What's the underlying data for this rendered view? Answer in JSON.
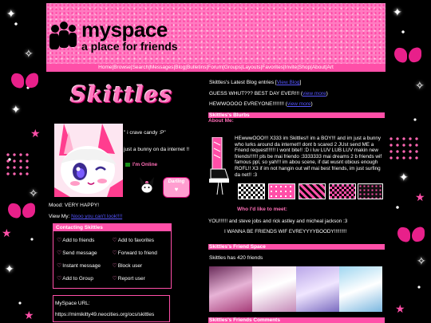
{
  "header": {
    "brand": "myspace",
    "tagline": "a place for friends"
  },
  "nav": {
    "items": [
      "Home",
      "Browse",
      "Search",
      "Messages",
      "Blog",
      "Bulletins",
      "Forum",
      "Groups",
      "Layouts",
      "Favorites",
      "Invite",
      "Shop",
      "About",
      "Art"
    ],
    "separator": "|"
  },
  "profile": {
    "display_name": "Skittles",
    "quotes": [
      "\" i crave candy :P\"",
      "just a bunny on da internet !!"
    ],
    "online_status": "I'm Online",
    "sticker_text": "Darling",
    "mood_label": "Mood:",
    "mood_value": "VERY HAPPY!",
    "view_my_label": "View My:",
    "view_my_link": "Nooo you can't look!!!!"
  },
  "contact": {
    "title": "Contacting Skittles",
    "items": [
      "Add to friends",
      "Add to favorites",
      "Send message",
      "Forward to friend",
      "Instant message",
      "Block user",
      "Add to Group",
      "Report user"
    ]
  },
  "url_box": {
    "label": "MySpace URL:",
    "url": "https://mimikitty49.neocities.org/ocs/skittles"
  },
  "blog": {
    "heading": "Skittles's Latest Blog entries",
    "heading_link": "View Blog",
    "entries": [
      {
        "text": "GUESS WHUT??? BEST DAY EVER!!!",
        "link": "view more"
      },
      {
        "text": "HEWWOOOO EVREYONE!!!!!!!!",
        "link": "view more"
      }
    ]
  },
  "blurbs": {
    "title": "Skittles's Blurbs",
    "about_label": "About Me:",
    "about_text": "HEwwwOOO!!! X333 im Skittles!! im a BOY!!! and im just a bunny who lurks around da internet!! dont b scared 2 JUst send ME a Friend request!!!!!! I wont bite!! :D i luv LUV LUB LUV makin new friends!!!!!! pls be mai friendo :3333333 mai dreams 2 b friends wif famous ppl, so yah!!! im abou scene, if dat wusnt obious enough ROFL!! X3 if im not hangin out wif mai best friends, im just surfing da net!! :3",
    "meet_label": "Who I'd like to meet:",
    "meet_text": "YOU!!!!!! and steve jobs and rick astley and micheal jackson :3",
    "wanna_text": "I WANNA BE FRIENDS WIF EVREYYYYBOODY!!!!!!!!!"
  },
  "friends": {
    "title": "Skittles's Friend Space",
    "count_text": "Skittles has 420 friends"
  },
  "comments": {
    "title": "Skittles's Friends Comments"
  },
  "colors": {
    "accent": "#ff4fa8",
    "link": "#5555ff",
    "background": "#000000"
  }
}
